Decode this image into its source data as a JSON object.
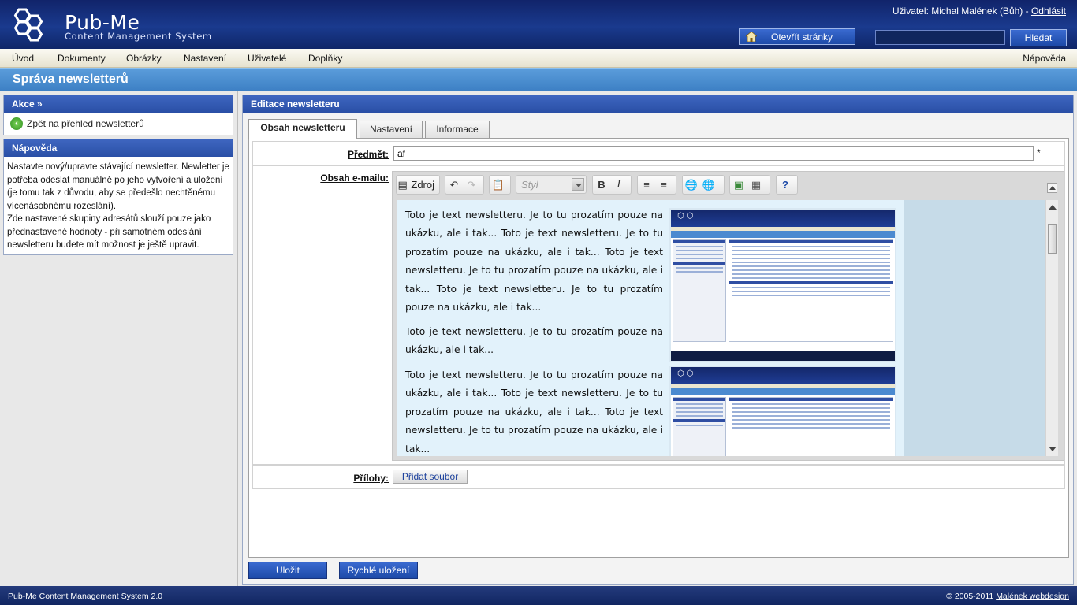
{
  "header": {
    "app_name": "Pub-Me",
    "app_subtitle": "Content Management System",
    "user_prefix": "Uživatel: Michal Malének (Bůh) -",
    "logout": "Odhlásit",
    "open_site": "Otevřít stránky",
    "search_value": "",
    "search_button": "Hledat"
  },
  "menu": {
    "items": [
      "Úvod",
      "Dokumenty",
      "Obrázky",
      "Nastavení",
      "Uživatelé",
      "Doplňky"
    ],
    "help": "Nápověda"
  },
  "page_title": "Správa newsletterů",
  "sidebar": {
    "actions_title": "Akce »",
    "back_link": "Zpět na přehled newsletterů",
    "help_title": "Nápověda",
    "help_text_1": "Nastavte nový/upravte stávající newsletter. Newletter je potřeba odeslat manuálně po jeho vytvoření a uložení (je tomu tak z důvodu, aby se předešlo nechtěnému vícenásobnému rozeslání).",
    "help_text_2": "Zde nastavené skupiny adresátů slouží pouze jako přednastavené hodnoty - při samotném odeslání newsletteru budete mít možnost je ještě upravit."
  },
  "editor_panel": {
    "title": "Editace newsletteru",
    "tabs": [
      "Obsah newsletteru",
      "Nastavení",
      "Informace"
    ],
    "subject_label": "Předmět:",
    "subject_value": "af",
    "required_mark": "*",
    "content_label": "Obsah e-mailu:",
    "attachments_label": "Přílohy:",
    "add_file": "Přidat soubor",
    "toolbar": {
      "source": "Zdroj",
      "style_placeholder": "Styl"
    },
    "paragraphs": [
      "Toto je text newsletteru. Je to tu prozatím pouze na ukázku, ale i tak... Toto je text newsletteru. Je to tu prozatím pouze na ukázku, ale i tak... Toto je text newsletteru. Je to tu prozatím pouze na ukázku, ale i tak... Toto je text newsletteru. Je to tu prozatím pouze na ukázku, ale i tak...",
      "Toto je text newsletteru. Je to tu prozatím pouze na ukázku, ale i tak...",
      "Toto je text newsletteru. Je to tu prozatím pouze na ukázku, ale i tak... Toto je text newsletteru. Je to tu prozatím pouze na ukázku, ale i tak... Toto je text newsletteru. Je to tu prozatím pouze na ukázku, ale i tak..."
    ],
    "save": "Uložit",
    "quick_save": "Rychlé uložení"
  },
  "footer": {
    "left": "Pub-Me Content Management System 2.0",
    "right_prefix": "© 2005-2011",
    "right_link": "Malének webdesign"
  },
  "colors": {
    "header_blue": "#1a3a8e",
    "title_blue": "#4a8ed2",
    "box_head_blue": "#3458b2",
    "editor_bg": "#e2f2fb"
  }
}
